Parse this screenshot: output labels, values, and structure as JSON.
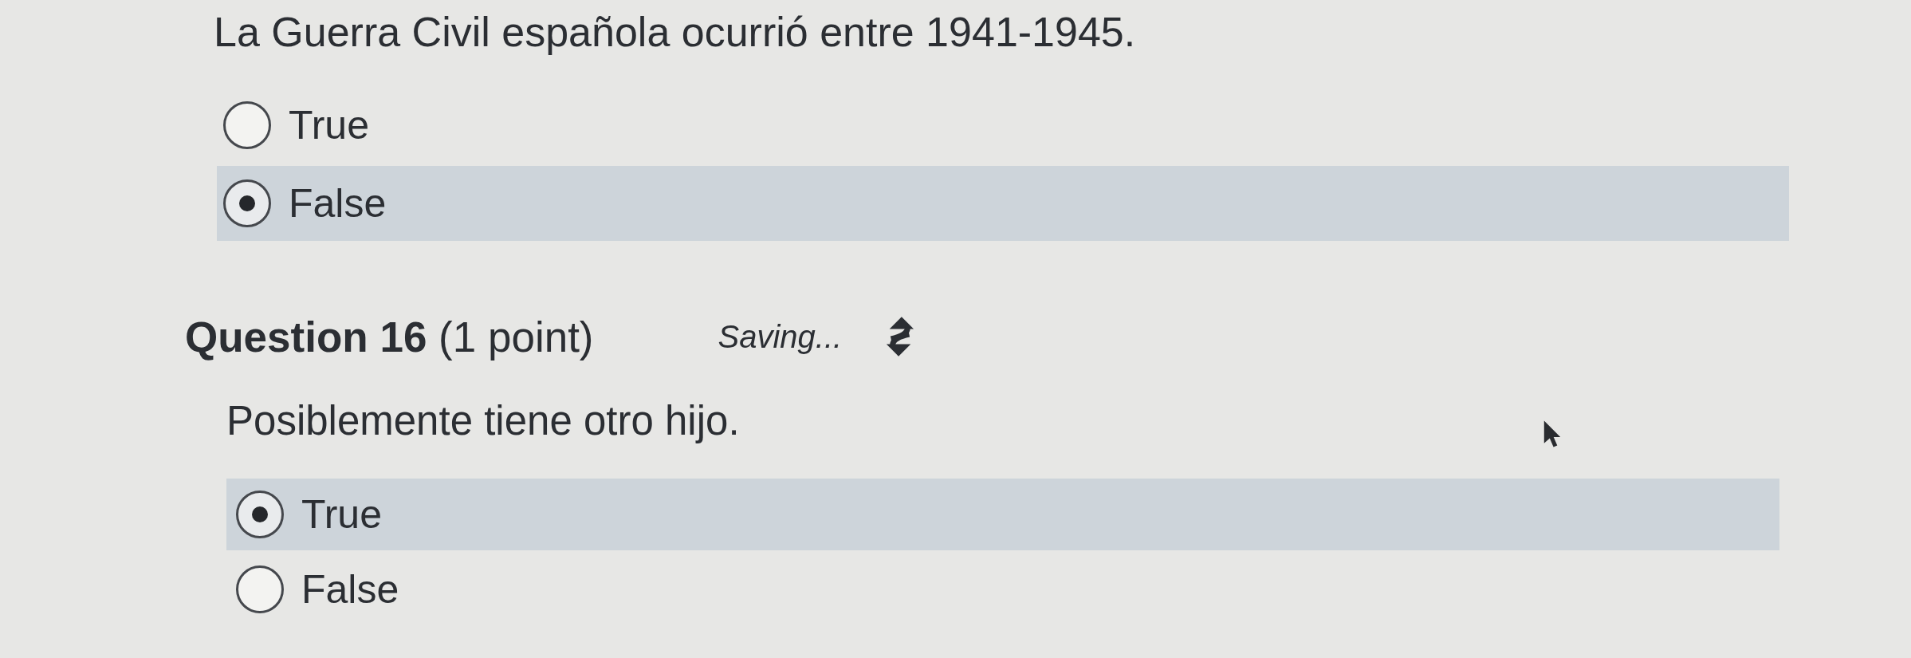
{
  "questions": [
    {
      "prompt": "La Guerra Civil española ocurrió entre 1941-1945.",
      "options": [
        {
          "label": "True",
          "selected": false
        },
        {
          "label": "False",
          "selected": true
        }
      ]
    },
    {
      "heading": "**Question 16** (1 point)",
      "status": "Saving...",
      "prompt": "Posiblemente tiene otro hijo.",
      "options": [
        {
          "label": "True",
          "selected": true
        },
        {
          "label": "False",
          "selected": false
        }
      ]
    }
  ]
}
